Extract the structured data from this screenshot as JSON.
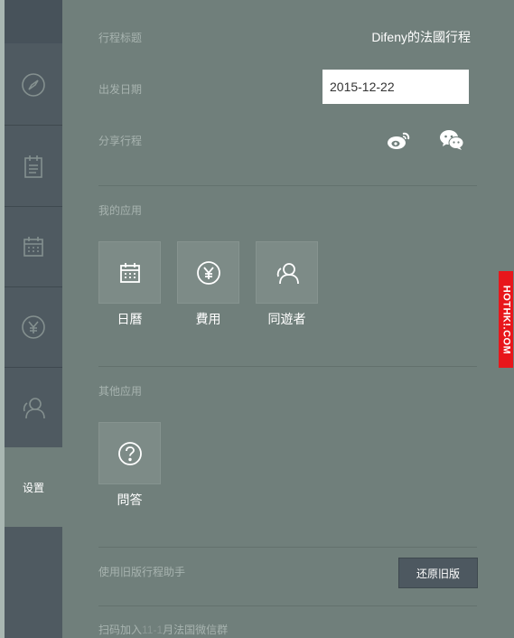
{
  "sidebar": {
    "items": [
      {
        "icon": "compass-icon"
      },
      {
        "icon": "notepad-icon"
      },
      {
        "icon": "calendar-icon"
      },
      {
        "icon": "yen-icon"
      },
      {
        "icon": "user-icon"
      }
    ],
    "settings_label": "设置"
  },
  "settings": {
    "title_label": "行程标题",
    "title_value": "Difeny的法國行程",
    "date_label": "出发日期",
    "date_value": "2015-12-22",
    "share_label": "分享行程",
    "share_icons": [
      "weibo-icon",
      "wechat-icon"
    ]
  },
  "my_apps": {
    "heading": "我的应用",
    "apps": [
      {
        "label": "日曆",
        "icon": "calendar-icon"
      },
      {
        "label": "費用",
        "icon": "yen-icon"
      },
      {
        "label": "同遊者",
        "icon": "companions-icon"
      }
    ]
  },
  "other_apps": {
    "heading": "其他应用",
    "apps": [
      {
        "label": "問答",
        "icon": "question-icon"
      }
    ]
  },
  "legacy": {
    "label": "使用旧版行程助手",
    "button_label": "还原旧版"
  },
  "qr": {
    "prefix": "扫码加入",
    "muted": "11-1",
    "suffix": "月法国微信群"
  },
  "watermark": "HOTHK!.COM",
  "colors": {
    "background": "#707f7b",
    "sidebar": "#4f5a61",
    "watermark": "#e8161b"
  }
}
